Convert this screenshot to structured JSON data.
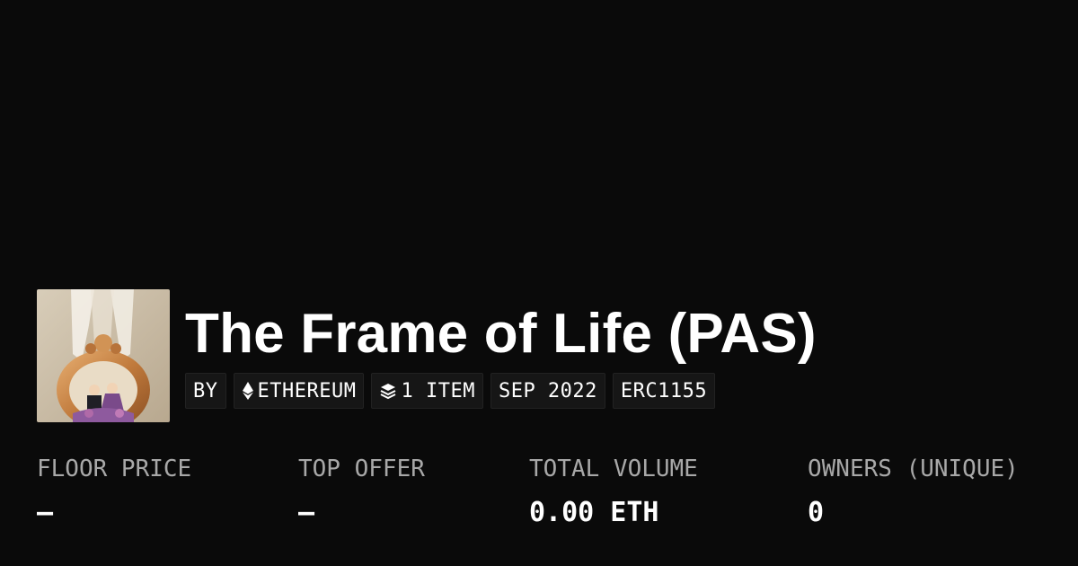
{
  "collection": {
    "image_icon": "wedding-couple-golden-frame-image",
    "title": "The Frame of Life (PAS)"
  },
  "tags": [
    {
      "label": "BY",
      "icon": null
    },
    {
      "label": "ETHEREUM",
      "icon": "ethereum-icon"
    },
    {
      "label": "1 ITEM",
      "icon": "layers-icon"
    },
    {
      "label": "SEP 2022",
      "icon": null
    },
    {
      "label": "ERC1155",
      "icon": null
    }
  ],
  "stats": [
    {
      "label": "FLOOR PRICE",
      "value": "—"
    },
    {
      "label": "TOP OFFER",
      "value": "—"
    },
    {
      "label": "TOTAL VOLUME",
      "value": "0.00 ETH"
    },
    {
      "label": "OWNERS (UNIQUE)",
      "value": "0"
    }
  ],
  "colors": {
    "background": "#0a0a0a",
    "text": "#ffffff",
    "muted_text": "#a8a8a8",
    "tag_background": "#161616"
  }
}
